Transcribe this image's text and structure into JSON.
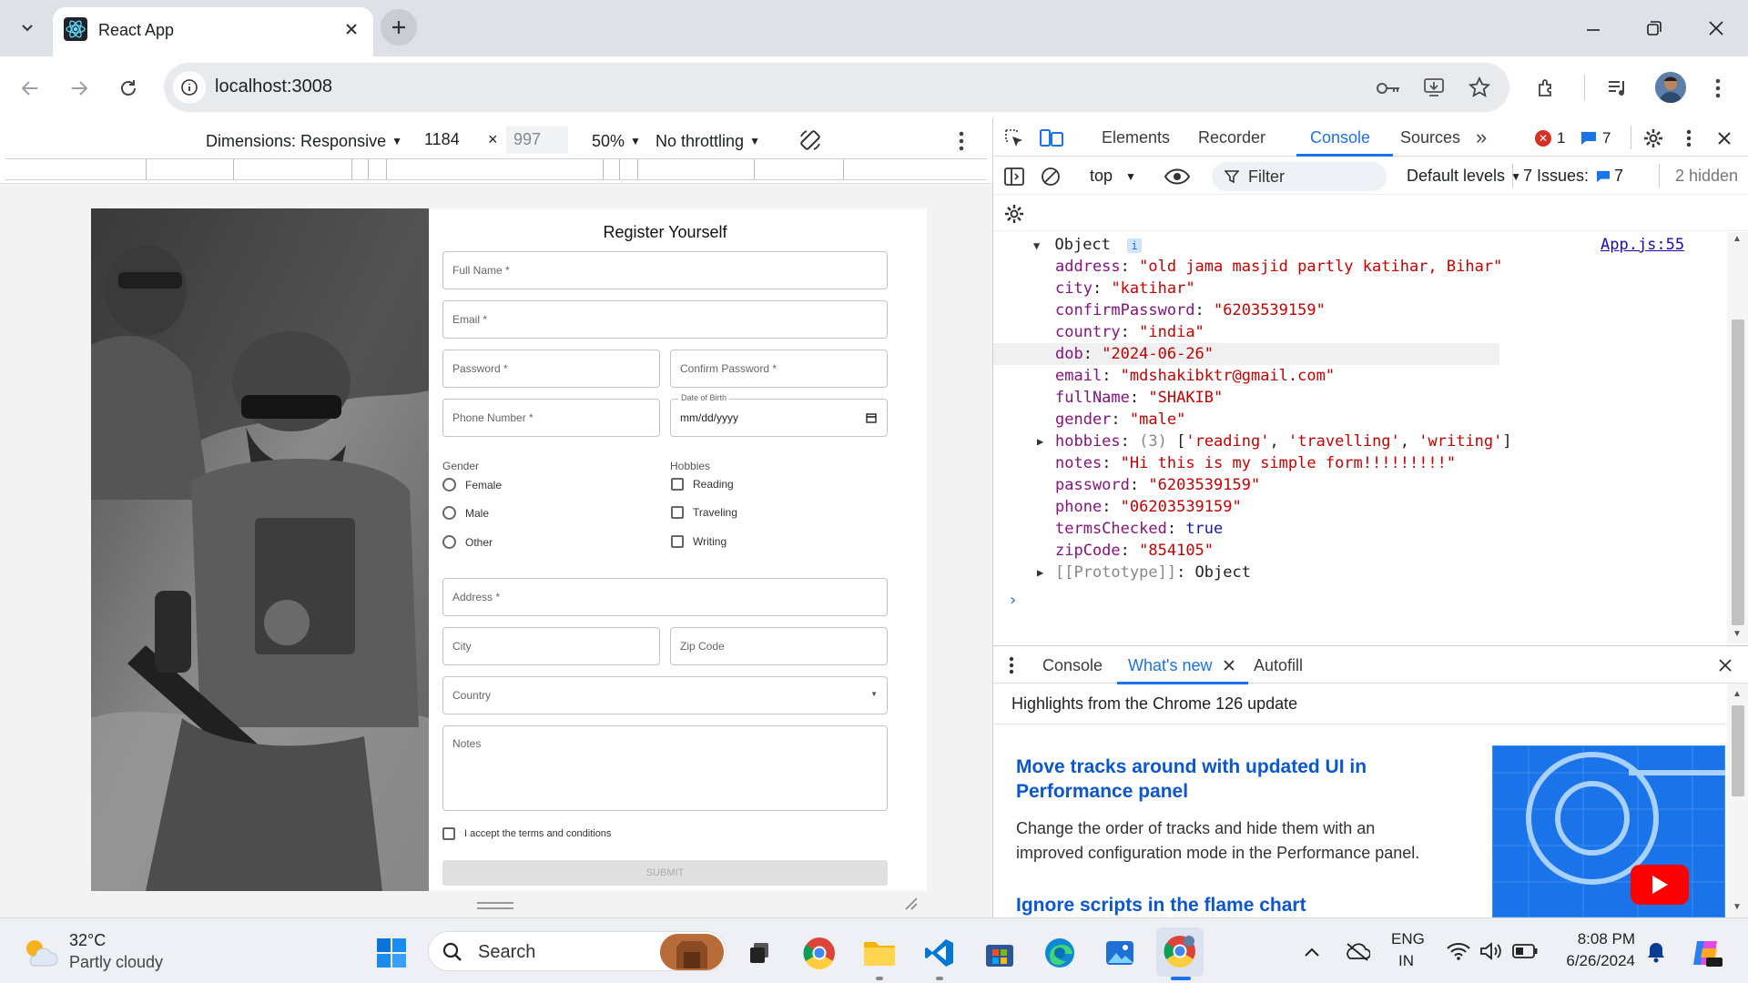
{
  "browser": {
    "tab_title": "React App",
    "url": "localhost:3008"
  },
  "emulation": {
    "dimensions_label": "Dimensions: Responsive",
    "width": "1184",
    "height": "997",
    "zoom": "50%",
    "throttling": "No throttling"
  },
  "form": {
    "title": "Register Yourself",
    "full_name": "Full Name *",
    "email": "Email *",
    "password": "Password *",
    "confirm_password": "Confirm Password *",
    "phone": "Phone Number *",
    "dob_label": "Date of Birth",
    "dob_placeholder": "mm/dd/yyyy",
    "gender_label": "Gender",
    "gender_options": [
      "Female",
      "Male",
      "Other"
    ],
    "hobbies_label": "Hobbies",
    "hobby_options": [
      "Reading",
      "Traveling",
      "Writing"
    ],
    "address": "Address *",
    "city": "City",
    "zip": "Zip Code",
    "country": "Country",
    "notes": "Notes",
    "terms": "I accept the terms and conditions",
    "submit": "SUBMIT"
  },
  "devtools": {
    "tabs": [
      "Elements",
      "Recorder",
      "Console",
      "Sources"
    ],
    "active_tab": "Console",
    "errors_count": "1",
    "messages_count": "7",
    "context": "top",
    "filter_placeholder": "Filter",
    "levels": "Default levels",
    "issues_label": "7 Issues:",
    "issues_count": "7",
    "hidden": "2 hidden",
    "object_label": "Object",
    "source_link": "App.js:55",
    "object_lines": [
      {
        "key": "address",
        "value": "\"old jama masjid partly katihar, Bihar\"",
        "type": "str"
      },
      {
        "key": "city",
        "value": "\"katihar\"",
        "type": "str"
      },
      {
        "key": "confirmPassword",
        "value": "\"6203539159\"",
        "type": "str"
      },
      {
        "key": "country",
        "value": "\"india\"",
        "type": "str"
      },
      {
        "key": "dob",
        "value": "\"2024-06-26\"",
        "type": "str"
      },
      {
        "key": "email",
        "value": "\"mdshakibktr@gmail.com\"",
        "type": "str"
      },
      {
        "key": "fullName",
        "value": "\"SHAKIB\"",
        "type": "str"
      },
      {
        "key": "gender",
        "value": "\"male\"",
        "type": "str"
      }
    ],
    "hobbies_key": "hobbies",
    "hobbies_count": "(3)",
    "hobbies_values": [
      "'reading'",
      "'travelling'",
      "'writing'"
    ],
    "object_lines2": [
      {
        "key": "notes",
        "value": "\"Hi this is my simple form!!!!!!!!!\"",
        "type": "str"
      },
      {
        "key": "password",
        "value": "\"6203539159\"",
        "type": "str"
      },
      {
        "key": "phone",
        "value": "\"06203539159\"",
        "type": "str"
      },
      {
        "key": "termsChecked",
        "value": "true",
        "type": "kw"
      },
      {
        "key": "zipCode",
        "value": "\"854105\"",
        "type": "str"
      }
    ],
    "prototype_key": "[[Prototype]]",
    "prototype_value": "Object",
    "drawer_tabs": [
      "Console",
      "What's new",
      "Autofill"
    ],
    "drawer_active": "What's new",
    "whats_new_header": "Highlights from the Chrome 126 update",
    "article1_title": "Move tracks around with updated UI in Performance panel",
    "article1_body": "Change the order of tracks and hide them with an improved configuration mode in the Performance panel.",
    "article2_title": "Ignore scripts in the flame chart"
  },
  "taskbar": {
    "temp": "32°C",
    "weather": "Partly cloudy",
    "search": "Search",
    "lang1": "ENG",
    "lang2": "IN",
    "time": "8:08 PM",
    "date": "6/26/2024"
  },
  "colors": {
    "accent": "#1a73e8",
    "string": "#c80000",
    "key": "#881280",
    "keyword": "#1a1aa6"
  }
}
